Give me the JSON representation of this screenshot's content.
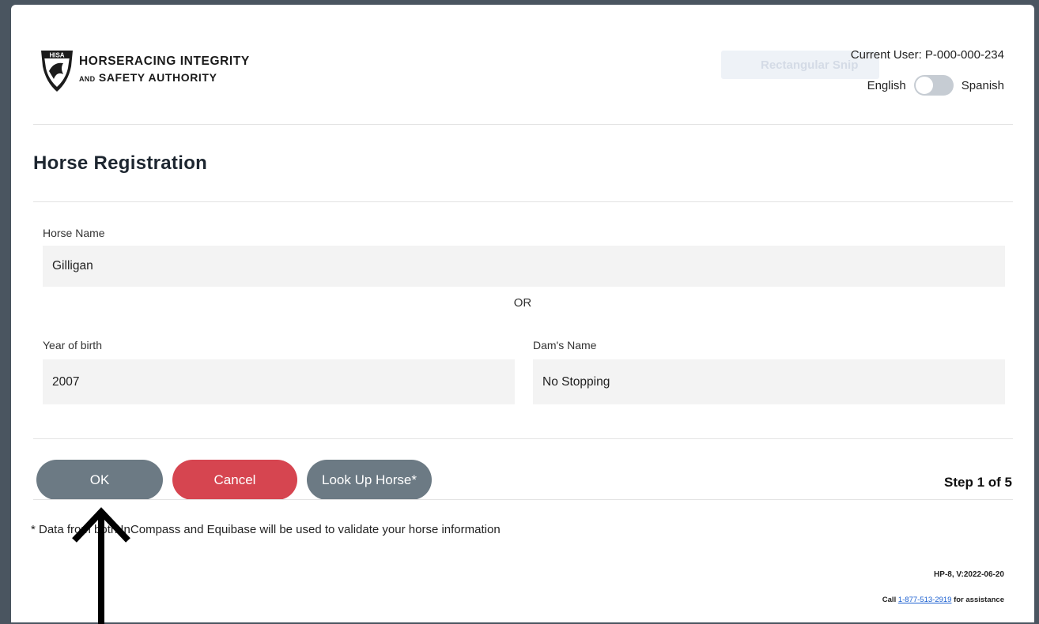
{
  "app": {
    "org_line1": "HORSERACING INTEGRITY",
    "org_line2_prefix": "AND",
    "org_line2_rest": " SAFETY AUTHORITY",
    "logo_badge": "HISA",
    "ghost_text": "Rectangular Snip"
  },
  "header": {
    "current_user": "Current User: P-000-000-234",
    "lang_left": "English",
    "lang_right": "Spanish",
    "lang_toggle_state": "off"
  },
  "page": {
    "title": "Horse Registration"
  },
  "form": {
    "horse_name_label": "Horse Name",
    "horse_name_value": "Gilligan",
    "or_text": "OR",
    "yob_label": "Year of birth",
    "yob_value": "2007",
    "dam_label": "Dam's Name",
    "dam_value": "No Stopping"
  },
  "actions": {
    "ok": "OK",
    "cancel": "Cancel",
    "lookup": "Look Up Horse*",
    "step": "Step 1 of 5"
  },
  "footer": {
    "note": "* Data from both InCompass and Equibase will be used to validate your horse information",
    "version": "HP-8, V:2022-06-20",
    "assist_prefix": "Call ",
    "phone": "1-877-513-2919",
    "assist_suffix": " for assistance"
  },
  "colors": {
    "primary_button": "#6c7a84",
    "cancel_button": "#d64550",
    "field_bg": "#f3f3f3"
  },
  "annotation": {
    "arrow_icon": "up-arrow-icon"
  }
}
